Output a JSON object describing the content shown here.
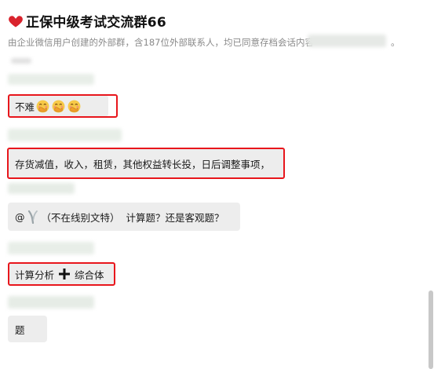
{
  "header": {
    "title": "正保中级考试交流群66",
    "subtitle": "由企业微信用户创建的外部群，含187位外部联系人，均已同意存档会话内容",
    "subtitle_suffix": "。"
  },
  "messages": [
    {
      "text": "不难",
      "emoji_count": 3,
      "emoji": "face-with-hand-over-mouth"
    },
    {
      "text": "存货减值，收入，租赁，其他权益转长投，日后调整事项，"
    },
    {
      "mention": "@",
      "mention_status": "（不在线别文特）",
      "text": "计算题？还是客观题？"
    },
    {
      "text_before": "计算分析",
      "icon": "plus-icon",
      "text_after": "综合体"
    },
    {
      "text": "题"
    }
  ],
  "colors": {
    "highlight": "#e8161c",
    "bubble": "#ededed",
    "heart": "#d9232d"
  }
}
